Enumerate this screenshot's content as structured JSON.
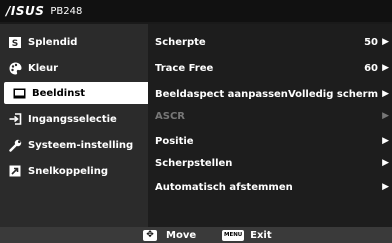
{
  "header": {
    "logo": "/ISUS",
    "model": "PB248"
  },
  "sidebar": {
    "items": [
      {
        "label": "Splendid",
        "icon": "splendid-icon"
      },
      {
        "label": "Kleur",
        "icon": "palette-icon"
      },
      {
        "label": "Beeldinst",
        "icon": "image-icon",
        "active": true
      },
      {
        "label": "Ingangsselectie",
        "icon": "input-icon"
      },
      {
        "label": "Systeem-instelling",
        "icon": "wrench-icon"
      },
      {
        "label": "Snelkoppeling",
        "icon": "shortcut-icon"
      }
    ]
  },
  "main": {
    "rows": [
      {
        "label": "Scherpte",
        "value": "50"
      },
      {
        "label": "Trace Free",
        "value": "60"
      },
      {
        "label": "Beeldaspect aanpassen",
        "value": "Volledig scherm"
      },
      {
        "label": "ASCR",
        "value": ""
      },
      {
        "label": "Positie",
        "value": ""
      },
      {
        "label": "Scherpstellen",
        "value": ""
      },
      {
        "label": "Automatisch afstemmen",
        "value": ""
      }
    ]
  },
  "footer": {
    "move_label": "Move",
    "menu_icon_text": "MENU",
    "exit_label": "Exit"
  },
  "colors": {
    "active_bg": "#ffffff",
    "disabled_text": "#777777"
  }
}
